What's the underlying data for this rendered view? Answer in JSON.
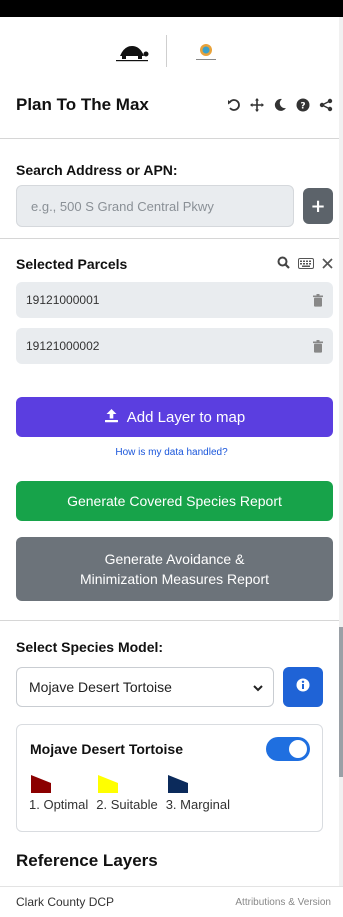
{
  "header": {
    "title": "Plan To The Max",
    "icons": [
      "undo-icon",
      "move-icon",
      "moon-icon",
      "help-icon",
      "share-icon"
    ]
  },
  "search": {
    "label": "Search Address or APN:",
    "placeholder": "e.g., 500 S Grand Central Pkwy",
    "add_label": "+"
  },
  "selected_parcels": {
    "title": "Selected Parcels",
    "items": [
      {
        "apn": "19121000001"
      },
      {
        "apn": "19121000002"
      }
    ]
  },
  "actions": {
    "add_layer_label": "Add Layer to map",
    "data_link": "How is my data handled?",
    "covered_species_label": "Generate Covered Species Report",
    "avoidance_line1": "Generate Avoidance &",
    "avoidance_line2": "Minimization Measures Report"
  },
  "species_model": {
    "label": "Select Species Model:",
    "selected": "Mojave Desert Tortoise"
  },
  "card": {
    "title": "Mojave Desert Tortoise",
    "toggle_on": true,
    "legend": [
      {
        "label": "1. Optimal",
        "color": "#8b0000"
      },
      {
        "label": "2. Suitable",
        "color": "#ffff00"
      },
      {
        "label": "3. Marginal",
        "color": "#0b2a5b"
      }
    ]
  },
  "reference": {
    "title": "Reference Layers"
  },
  "footer": {
    "org": "Clark County DCP",
    "attribution": "Attributions & Version"
  },
  "colors": {
    "add_layer": "#5b3ee0",
    "covered_species": "#17a34a",
    "avoidance": "#6c737a",
    "info": "#1f63d6",
    "toggle": "#1f6fe0"
  }
}
